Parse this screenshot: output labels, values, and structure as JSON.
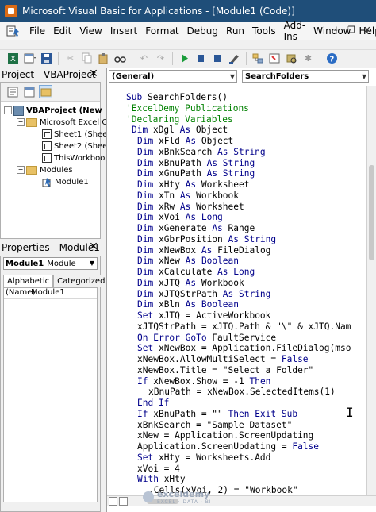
{
  "window": {
    "title": "Microsoft Visual Basic for Applications - [Module1 (Code)]"
  },
  "menu": {
    "items": [
      "File",
      "Edit",
      "View",
      "Insert",
      "Format",
      "Debug",
      "Run",
      "Tools",
      "Add-Ins",
      "Window",
      "Help"
    ]
  },
  "project_pane": {
    "title": "Project - VBAProject",
    "tree": {
      "project": "VBAProject (New M",
      "excel_objects": "Microsoft Excel Ob",
      "sheet1": "Sheet1 (Shee",
      "sheet2": "Sheet2 (Shee",
      "thisworkbook": "ThisWorkbook",
      "modules": "Modules",
      "module1": "Module1"
    }
  },
  "properties_pane": {
    "title": "Properties - Module1",
    "object_name": "Module1",
    "object_type": "Module",
    "tabs": [
      "Alphabetic",
      "Categorized"
    ],
    "rows": [
      {
        "key": "(Name)",
        "value": "Module1"
      }
    ]
  },
  "code_window": {
    "object_combo": "(General)",
    "procedure_combo": "SearchFolders",
    "lines": [
      {
        "indent": 0,
        "parts": [
          [
            "kw",
            "Sub "
          ],
          [
            "",
            "SearchFolders()"
          ]
        ]
      },
      {
        "indent": 0,
        "parts": [
          [
            "cm",
            "'ExcelDemy Publications"
          ]
        ]
      },
      {
        "indent": 0,
        "parts": [
          [
            "cm",
            "'Declaring Variables"
          ]
        ]
      },
      {
        "indent": 1,
        "parts": [
          [
            "kw",
            "Dim "
          ],
          [
            "",
            "xDgl "
          ],
          [
            "kw",
            "As "
          ],
          [
            "",
            "Object"
          ]
        ]
      },
      {
        "indent": 2,
        "parts": [
          [
            "kw",
            "Dim "
          ],
          [
            "",
            "xFld "
          ],
          [
            "kw",
            "As "
          ],
          [
            "",
            "Object"
          ]
        ]
      },
      {
        "indent": 2,
        "parts": [
          [
            "kw",
            "Dim "
          ],
          [
            "",
            "xBnkSearch "
          ],
          [
            "kw",
            "As String"
          ]
        ]
      },
      {
        "indent": 2,
        "parts": [
          [
            "kw",
            "Dim "
          ],
          [
            "",
            "xBnuPath "
          ],
          [
            "kw",
            "As String"
          ]
        ]
      },
      {
        "indent": 2,
        "parts": [
          [
            "kw",
            "Dim "
          ],
          [
            "",
            "xGnuPath "
          ],
          [
            "kw",
            "As String"
          ]
        ]
      },
      {
        "indent": 2,
        "parts": [
          [
            "kw",
            "Dim "
          ],
          [
            "",
            "xHty "
          ],
          [
            "kw",
            "As "
          ],
          [
            "",
            "Worksheet"
          ]
        ]
      },
      {
        "indent": 2,
        "parts": [
          [
            "kw",
            "Dim "
          ],
          [
            "",
            "xTn "
          ],
          [
            "kw",
            "As "
          ],
          [
            "",
            "Workbook"
          ]
        ]
      },
      {
        "indent": 2,
        "parts": [
          [
            "kw",
            "Dim "
          ],
          [
            "",
            "xRw "
          ],
          [
            "kw",
            "As "
          ],
          [
            "",
            "Worksheet"
          ]
        ]
      },
      {
        "indent": 2,
        "parts": [
          [
            "kw",
            "Dim "
          ],
          [
            "",
            "xVoi "
          ],
          [
            "kw",
            "As Long"
          ]
        ]
      },
      {
        "indent": 2,
        "parts": [
          [
            "kw",
            "Dim "
          ],
          [
            "",
            "xGenerate "
          ],
          [
            "kw",
            "As "
          ],
          [
            "",
            "Range"
          ]
        ]
      },
      {
        "indent": 2,
        "parts": [
          [
            "kw",
            "Dim "
          ],
          [
            "",
            "xGbrPosition "
          ],
          [
            "kw",
            "As String"
          ]
        ]
      },
      {
        "indent": 2,
        "parts": [
          [
            "kw",
            "Dim "
          ],
          [
            "",
            "xNewBox "
          ],
          [
            "kw",
            "As "
          ],
          [
            "",
            "FileDialog"
          ]
        ]
      },
      {
        "indent": 2,
        "parts": [
          [
            "kw",
            "Dim "
          ],
          [
            "",
            "xNew "
          ],
          [
            "kw",
            "As Boolean"
          ]
        ]
      },
      {
        "indent": 2,
        "parts": [
          [
            "kw",
            "Dim "
          ],
          [
            "",
            "xCalculate "
          ],
          [
            "kw",
            "As Long"
          ]
        ]
      },
      {
        "indent": 2,
        "parts": [
          [
            "kw",
            "Dim "
          ],
          [
            "",
            "xJTQ "
          ],
          [
            "kw",
            "As "
          ],
          [
            "",
            "Workbook"
          ]
        ]
      },
      {
        "indent": 2,
        "parts": [
          [
            "kw",
            "Dim "
          ],
          [
            "",
            "xJTQStrPath "
          ],
          [
            "kw",
            "As String"
          ]
        ]
      },
      {
        "indent": 2,
        "parts": [
          [
            "kw",
            "Dim "
          ],
          [
            "",
            "xBln "
          ],
          [
            "kw",
            "As Boolean"
          ]
        ]
      },
      {
        "indent": 2,
        "parts": [
          [
            "kw",
            "Set "
          ],
          [
            "",
            "xJTQ = ActiveWorkbook"
          ]
        ]
      },
      {
        "indent": 2,
        "parts": [
          [
            "",
            "xJTQStrPath = xJTQ.Path & \"\\\" & xJTQ.Nam"
          ]
        ]
      },
      {
        "indent": 2,
        "parts": [
          [
            "kw",
            "On Error GoTo "
          ],
          [
            "",
            "FaultService"
          ]
        ]
      },
      {
        "indent": 2,
        "parts": [
          [
            "kw",
            "Set "
          ],
          [
            "",
            "xNewBox = Application.FileDialog(mso"
          ]
        ]
      },
      {
        "indent": 2,
        "parts": [
          [
            "",
            "xNewBox.AllowMultiSelect = "
          ],
          [
            "kw",
            "False"
          ]
        ]
      },
      {
        "indent": 2,
        "parts": [
          [
            "",
            "xNewBox.Title = \"Select a Folder\""
          ]
        ]
      },
      {
        "indent": 2,
        "parts": [
          [
            "kw",
            "If "
          ],
          [
            "",
            "xNewBox.Show = -1 "
          ],
          [
            "kw",
            "Then"
          ]
        ]
      },
      {
        "indent": 4,
        "parts": [
          [
            "",
            "xBnuPath = xNewBox.SelectedItems(1)"
          ]
        ]
      },
      {
        "indent": 2,
        "parts": [
          [
            "kw",
            "End If"
          ]
        ]
      },
      {
        "indent": 2,
        "parts": [
          [
            "kw",
            "If "
          ],
          [
            "",
            "xBnuPath = \"\" "
          ],
          [
            "kw",
            "Then Exit Sub"
          ]
        ]
      },
      {
        "indent": 2,
        "parts": [
          [
            "",
            "xBnkSearch = \"Sample Dataset\""
          ]
        ]
      },
      {
        "indent": 2,
        "parts": [
          [
            "",
            "xNew = Application.ScreenUpdating"
          ]
        ]
      },
      {
        "indent": 2,
        "parts": [
          [
            "",
            "Application.ScreenUpdating = "
          ],
          [
            "kw",
            "False"
          ]
        ]
      },
      {
        "indent": 2,
        "parts": [
          [
            "kw",
            "Set "
          ],
          [
            "",
            "xHty = Worksheets.Add"
          ]
        ]
      },
      {
        "indent": 2,
        "parts": [
          [
            "",
            "xVoi = 4"
          ]
        ]
      },
      {
        "indent": 2,
        "parts": [
          [
            "kw",
            "With "
          ],
          [
            "",
            "xHty"
          ]
        ]
      },
      {
        "indent": 4,
        "parts": [
          [
            "",
            ".Cells(xVoi, 2) = \"Workbook\""
          ]
        ]
      }
    ]
  },
  "watermark": {
    "name": "exceldemy",
    "tagline": "EXCEL · DATA · BI"
  },
  "colors": {
    "titlebar": "#1f4e79",
    "keyword": "#00008b",
    "comment": "#008000"
  }
}
